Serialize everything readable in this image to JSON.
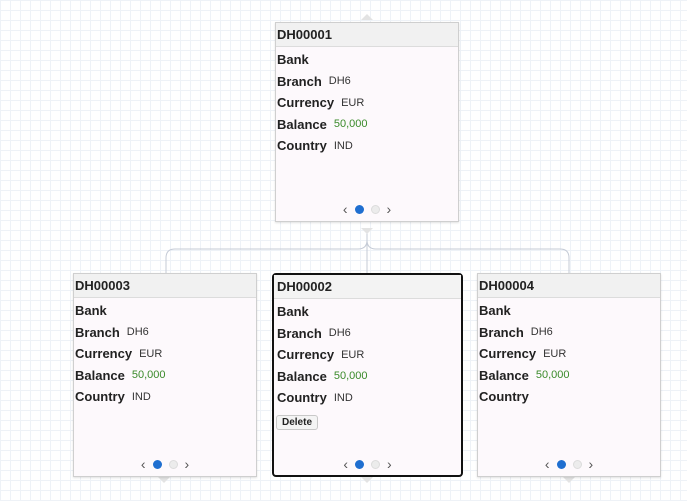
{
  "labels": {
    "bank": "Bank",
    "branch": "Branch",
    "currency": "Currency",
    "balance": "Balance",
    "country": "Country"
  },
  "nodes": {
    "root": {
      "id": "DH00001",
      "branch": "DH6",
      "currency": "EUR",
      "balance": "50,000",
      "country": "IND"
    },
    "left": {
      "id": "DH00003",
      "branch": "DH6",
      "currency": "EUR",
      "balance": "50,000",
      "country": "IND"
    },
    "middle": {
      "id": "DH00002",
      "branch": "DH6",
      "currency": "EUR",
      "balance": "50,000",
      "country": "IND",
      "delete_label": "Delete"
    },
    "right": {
      "id": "DH00004",
      "branch": "DH6",
      "currency": "EUR",
      "balance": "50,000"
    }
  },
  "pager": {
    "prev": "‹",
    "next": "›",
    "active_index": 0,
    "page_count": 2
  },
  "colors": {
    "accent": "#1f6fd0",
    "money": "#3a8a2a",
    "selected_border": "#111111"
  }
}
